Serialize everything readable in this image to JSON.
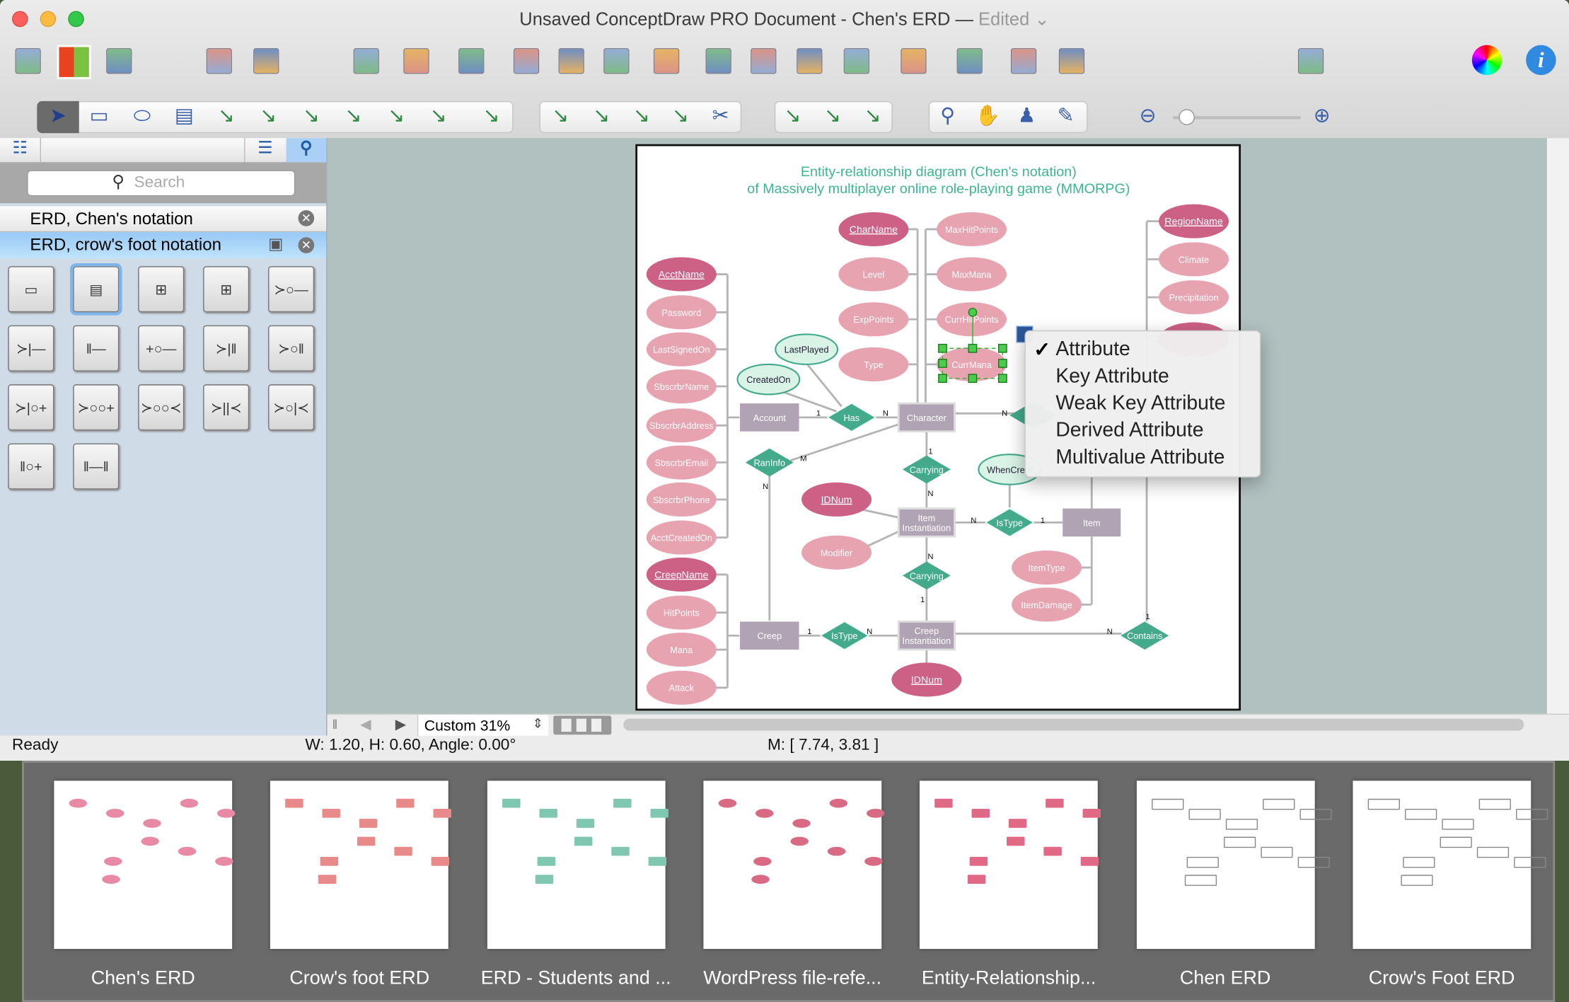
{
  "window": {
    "title": "Unsaved ConceptDraw PRO Document - Chen's ERD",
    "separator": " — ",
    "edited": "Edited"
  },
  "toolbar_top": {
    "icons": [
      "library-grid-icon",
      "color-palette-icon",
      "save-disk-icon",
      "connect-tree-icon",
      "group-icon",
      "tree-layout-icon",
      "align-left-icon",
      "distribute-icon",
      "bring-front-icon",
      "send-back-icon",
      "bring-forward-icon",
      "shape-fill-icon",
      "connector-elbow-icon",
      "connector-direct-icon",
      "network-icon",
      "hierarchy-icon",
      "org-chart-icon",
      "page-icon",
      "grid-icon",
      "rotate-arrows-icon",
      "text-format-icon",
      "color-wheel-icon",
      "info-icon"
    ]
  },
  "toolbar_drawing": {
    "icons": [
      "pointer-icon",
      "rectangle-tool-icon",
      "ellipse-tool-icon",
      "text-block-icon",
      "connector-direct-icon",
      "connector-arc-icon",
      "connector-bezier-icon",
      "connector-orthogonal-icon",
      "connector-smart-icon",
      "connector-round-icon",
      "insert-picture-icon",
      "line-tool-icon",
      "arc-tool-icon",
      "bezier-tool-icon",
      "polyline-tool-icon",
      "scissors-icon",
      "snap-icon",
      "group-edit-icon",
      "ungroup-icon",
      "zoom-magnifier-icon",
      "hand-pan-icon",
      "stamp-icon",
      "eyedropper-icon",
      "zoom-out-icon",
      "zoom-in-icon"
    ],
    "zoom_slider_level": 0.1
  },
  "library": {
    "search_placeholder": "Search",
    "items": [
      {
        "label": "ERD, Chen's notation",
        "selected": false
      },
      {
        "label": "ERD, crow's foot notation",
        "selected": true
      }
    ],
    "shape_count": 17
  },
  "canvas": {
    "zoom_label": "Custom 31%"
  },
  "status": {
    "ready": "Ready",
    "dims": "W: 1.20,  H: 0.60,  Angle: 0.00°",
    "mouse": "M: [ 7.74, 3.81 ]"
  },
  "diagram": {
    "title1": "Entity-relationship diagram (Chen's notation)",
    "title2": "of Massively multiplayer online role-playing game (MMORPG)",
    "colors": {
      "key": "#cc6185",
      "attr": "#e8a3b1",
      "entity": "#b0a3b4",
      "relation": "#43aa8b",
      "derived_fill": "#d9f3e7",
      "title": "#3db58f"
    },
    "attributes": [
      "AcctName",
      "Password",
      "LastSignedOn",
      "SbscrbrName",
      "SbscrbrAddress",
      "SbscrbrEmail",
      "SbscrbrPhone",
      "AcctCreatedOn",
      "CreepName",
      "HitPoints",
      "Mana",
      "Attack",
      "CharName",
      "Level",
      "ExpPoints",
      "Type",
      "MaxHitPoints",
      "MaxMana",
      "CurrHitPoints",
      "CurrMana",
      "RegionName",
      "Climate",
      "Precipitation",
      "",
      "LastPlayed",
      "CreatedOn",
      "WhenCreat",
      "IDNum",
      "Modifier",
      "ItemType",
      "ItemDamage",
      "IDNum"
    ],
    "entities": [
      "Account",
      "Character",
      "Item\nInstantiation",
      "Item",
      "Creep",
      "Creep\nInstantiation"
    ],
    "relationships": [
      "Has",
      "RanInfo",
      "Carrying",
      "IsType",
      "Carrying",
      "IsType",
      "Contains",
      ""
    ],
    "cardinalities": [
      "1",
      "N",
      "N",
      "1",
      "N",
      "M",
      "N",
      "N",
      "1",
      "N",
      "1",
      "1",
      "N",
      "N",
      "1"
    ]
  },
  "context_menu": {
    "items": [
      {
        "label": "Attribute",
        "checked": true
      },
      {
        "label": "Key Attribute",
        "checked": false
      },
      {
        "label": "Weak Key Attribute",
        "checked": false
      },
      {
        "label": "Derived Attribute",
        "checked": false
      },
      {
        "label": "Multivalue Attribute",
        "checked": false
      }
    ]
  },
  "thumbnails": [
    "Chen's ERD",
    "Crow's foot ERD",
    "ERD - Students and ...",
    "WordPress file-refe...",
    "Entity-Relationship...",
    "Chen ERD",
    "Crow's Foot ERD"
  ]
}
